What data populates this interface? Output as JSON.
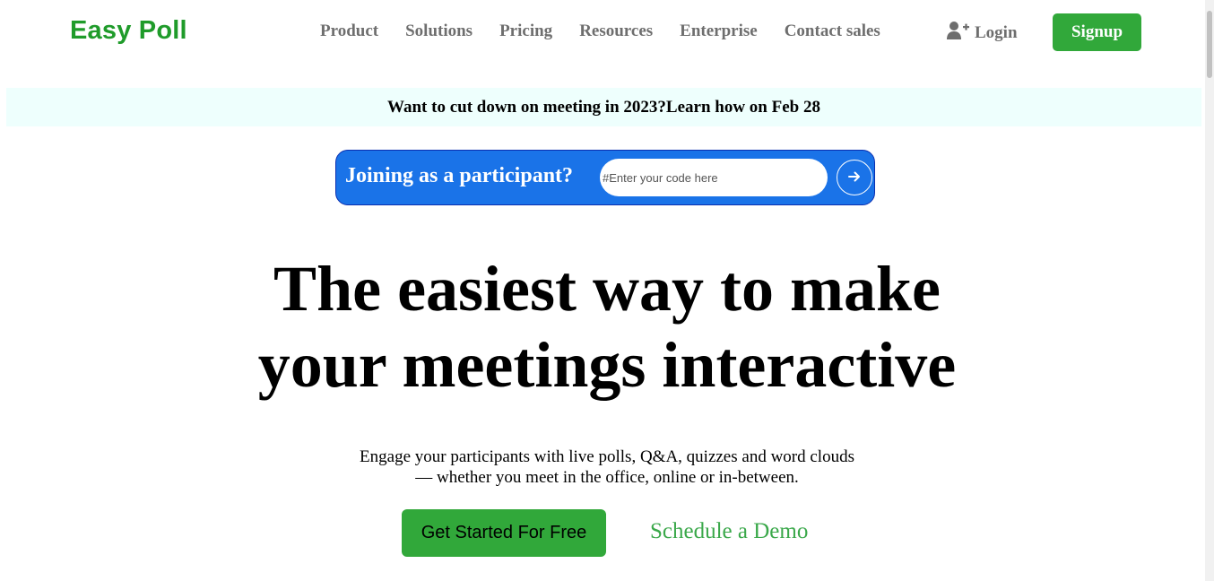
{
  "header": {
    "logo": "Easy Poll",
    "nav": [
      "Product",
      "Solutions",
      "Pricing",
      "Resources",
      "Enterprise",
      "Contact sales"
    ],
    "login_label": "Login",
    "signup_label": "Signup"
  },
  "announcement": "Want to cut down on meeting in 2023?Learn how on Feb 28",
  "join": {
    "label": "Joining as a participant?",
    "placeholder": "#Enter your code here"
  },
  "hero": {
    "line1": "The easiest way to make",
    "line2": "your meetings interactive"
  },
  "subtitle": {
    "line1": "Engage your participants with live polls, Q&A, quizzes and word clouds",
    "line2": "— whether you meet in the office, online or in-between."
  },
  "cta": {
    "primary": "Get Started For Free",
    "secondary": "Schedule a Demo"
  },
  "colors": {
    "brand_green": "#31a83a",
    "logo_green": "#1f9b2a",
    "join_blue": "#1a73e8",
    "announce_bg": "#eefffd"
  }
}
